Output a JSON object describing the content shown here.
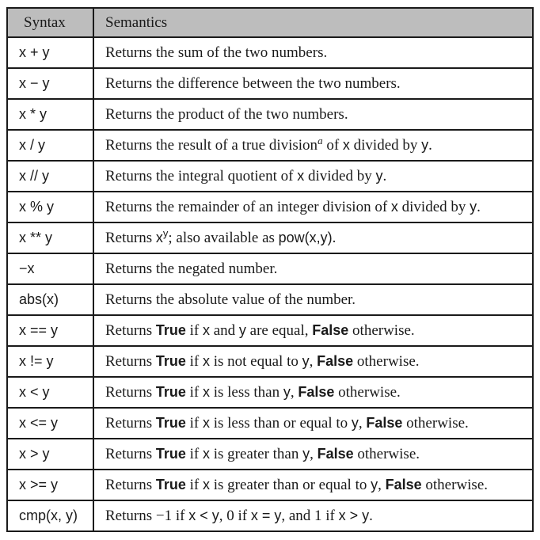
{
  "table": {
    "header": {
      "syntax": "Syntax",
      "semantics": "Semantics"
    },
    "rows": [
      {
        "syntax": "x + y",
        "semantics": [
          {
            "t": "Returns the sum of the two numbers."
          }
        ]
      },
      {
        "syntax": "x − y",
        "semantics": [
          {
            "t": "Returns the difference between the two numbers."
          }
        ]
      },
      {
        "syntax": "x * y",
        "semantics": [
          {
            "t": "Returns the product of the two numbers."
          }
        ]
      },
      {
        "syntax": "x / y",
        "semantics": [
          {
            "t": "Returns the result of a true division"
          },
          {
            "t": "a",
            "s": "sup-a"
          },
          {
            "t": " of "
          },
          {
            "t": "x",
            "s": "code"
          },
          {
            "t": " divided by "
          },
          {
            "t": "y",
            "s": "code"
          },
          {
            "t": "."
          }
        ]
      },
      {
        "syntax": "x // y",
        "semantics": [
          {
            "t": "Returns the integral quotient of "
          },
          {
            "t": "x",
            "s": "code"
          },
          {
            "t": " divided by "
          },
          {
            "t": "y",
            "s": "code"
          },
          {
            "t": "."
          }
        ]
      },
      {
        "syntax": "x % y",
        "semantics": [
          {
            "t": "Returns the remainder of an integer division of "
          },
          {
            "t": "x",
            "s": "code"
          },
          {
            "t": " divided by "
          },
          {
            "t": "y",
            "s": "code"
          },
          {
            "t": "."
          }
        ]
      },
      {
        "syntax": "x ** y",
        "semantics": [
          {
            "t": "Returns "
          },
          {
            "t": "x",
            "s": "code"
          },
          {
            "t": "y",
            "s": "sup-y"
          },
          {
            "t": "; also available as "
          },
          {
            "t": "pow(x,y)",
            "s": "code"
          },
          {
            "t": "."
          }
        ]
      },
      {
        "syntax": "−x",
        "semantics": [
          {
            "t": "Returns the negated number."
          }
        ]
      },
      {
        "syntax": "abs(x)",
        "semantics": [
          {
            "t": "Returns the absolute value of the number."
          }
        ]
      },
      {
        "syntax": "x == y",
        "semantics": [
          {
            "t": "Returns "
          },
          {
            "t": "True",
            "s": "kw"
          },
          {
            "t": " if "
          },
          {
            "t": "x",
            "s": "code"
          },
          {
            "t": " and "
          },
          {
            "t": "y",
            "s": "code"
          },
          {
            "t": " are equal, "
          },
          {
            "t": "False",
            "s": "kw"
          },
          {
            "t": " otherwise."
          }
        ]
      },
      {
        "syntax": "x != y",
        "semantics": [
          {
            "t": "Returns "
          },
          {
            "t": "True",
            "s": "kw"
          },
          {
            "t": " if "
          },
          {
            "t": "x",
            "s": "code"
          },
          {
            "t": " is not equal to "
          },
          {
            "t": "y",
            "s": "code"
          },
          {
            "t": ", "
          },
          {
            "t": "False",
            "s": "kw"
          },
          {
            "t": " otherwise."
          }
        ]
      },
      {
        "syntax": "x < y",
        "semantics": [
          {
            "t": "Returns "
          },
          {
            "t": "True",
            "s": "kw"
          },
          {
            "t": " if "
          },
          {
            "t": "x",
            "s": "code"
          },
          {
            "t": " is less than "
          },
          {
            "t": "y",
            "s": "code"
          },
          {
            "t": ", "
          },
          {
            "t": "False",
            "s": "kw"
          },
          {
            "t": " otherwise."
          }
        ]
      },
      {
        "syntax": "x <= y",
        "semantics": [
          {
            "t": "Returns "
          },
          {
            "t": "True",
            "s": "kw"
          },
          {
            "t": " if "
          },
          {
            "t": "x",
            "s": "code"
          },
          {
            "t": " is less than or equal to "
          },
          {
            "t": "y",
            "s": "code"
          },
          {
            "t": ", "
          },
          {
            "t": "False",
            "s": "kw"
          },
          {
            "t": " otherwise."
          }
        ]
      },
      {
        "syntax": "x > y",
        "semantics": [
          {
            "t": "Returns "
          },
          {
            "t": "True",
            "s": "kw"
          },
          {
            "t": " if "
          },
          {
            "t": "x",
            "s": "code"
          },
          {
            "t": " is greater than "
          },
          {
            "t": "y",
            "s": "code"
          },
          {
            "t": ", "
          },
          {
            "t": "False",
            "s": "kw"
          },
          {
            "t": " otherwise."
          }
        ]
      },
      {
        "syntax": "x >= y",
        "semantics": [
          {
            "t": "Returns "
          },
          {
            "t": "True",
            "s": "kw"
          },
          {
            "t": " if "
          },
          {
            "t": "x",
            "s": "code"
          },
          {
            "t": " is greater than or equal to "
          },
          {
            "t": "y",
            "s": "code"
          },
          {
            "t": ", "
          },
          {
            "t": "False",
            "s": "kw"
          },
          {
            "t": " otherwise."
          }
        ]
      },
      {
        "syntax": "cmp(x, y)",
        "semantics": [
          {
            "t": "Returns −1 if "
          },
          {
            "t": "x < y",
            "s": "code"
          },
          {
            "t": ", 0 if "
          },
          {
            "t": "x = y",
            "s": "code"
          },
          {
            "t": ", and 1 if "
          },
          {
            "t": "x > y",
            "s": "code"
          },
          {
            "t": "."
          }
        ]
      }
    ]
  }
}
